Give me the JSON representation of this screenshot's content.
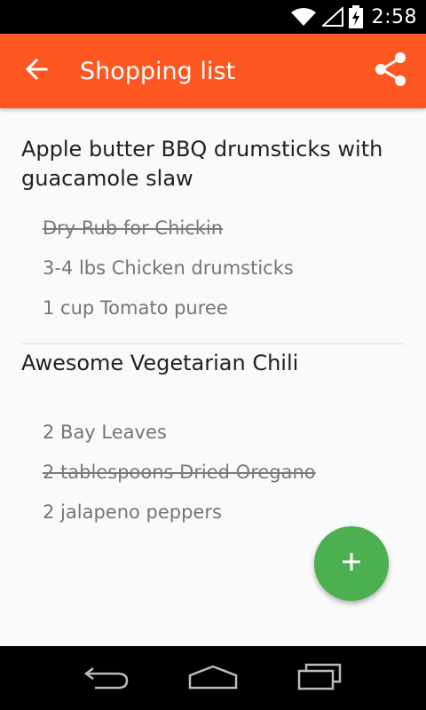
{
  "status_bar": {
    "time": "2:58"
  },
  "app_bar": {
    "title": "Shopping list",
    "back_icon": "arrow-back-icon",
    "share_icon": "share-icon"
  },
  "recipes": [
    {
      "title": "Apple butter BBQ drumsticks with guacamole slaw",
      "ingredients": [
        {
          "text": "Dry Rub for Chickin",
          "checked": true
        },
        {
          "text": "3-4 lbs Chicken drumsticks",
          "checked": false
        },
        {
          "text": "1 cup Tomato puree",
          "checked": false
        }
      ]
    },
    {
      "title": "Awesome Vegetarian Chili",
      "ingredients": [
        {
          "text": "2 Bay Leaves",
          "checked": false
        },
        {
          "text": "2 tablespoons Dried Oregano",
          "checked": true
        },
        {
          "text": "2 jalapeno peppers",
          "checked": false
        }
      ]
    }
  ],
  "fab": {
    "icon": "add-icon"
  },
  "colors": {
    "app_bar": "#ff5722",
    "fab": "#4caf50"
  }
}
